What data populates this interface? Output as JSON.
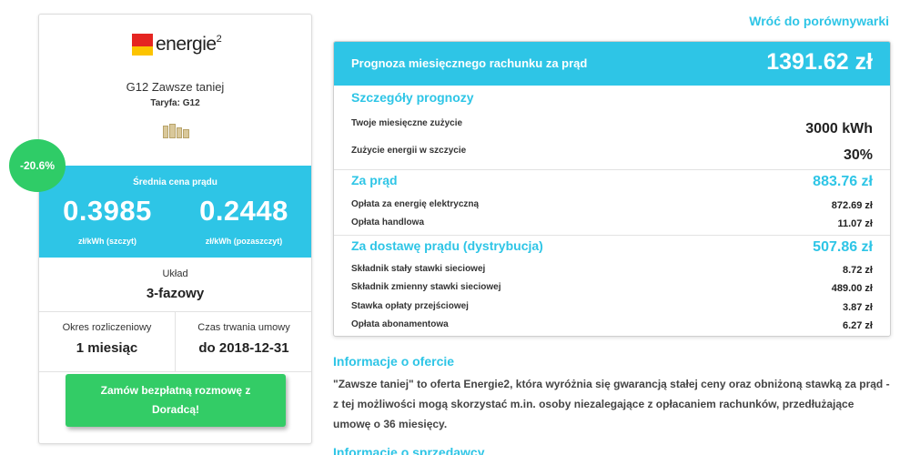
{
  "offer": {
    "brand_name": "energie",
    "brand_sup": "2",
    "tariff_name": "G12 Zawsze taniej",
    "tariff_code": "Taryfa: G12",
    "discount_badge": "-20.6%",
    "avg_price_label": "Średnia cena prądu",
    "peak_price": "0.3985",
    "peak_unit": "zł/kWh (szczyt)",
    "offpeak_price": "0.2448",
    "offpeak_unit": "zł/kWh (pozaszczyt)",
    "system_label": "Układ",
    "system_value": "3-fazowy",
    "billing_label": "Okres rozliczeniowy",
    "billing_value": "1 miesiąc",
    "contract_label": "Czas trwania umowy",
    "contract_value": "do 2018-12-31",
    "cta_label": "Zamów bezpłatną rozmowę z Doradcą!"
  },
  "back_link": "Wróć do porównywarki",
  "forecast": {
    "header_title": "Prognoza miesięcznego rachunku za prąd",
    "header_value": "1391.62 zł",
    "details_title": "Szczegóły prognozy",
    "usage_label": "Twoje miesięczne zużycie",
    "usage_value": "3000 kWh",
    "peak_share_label": "Zużycie energii w szczycie",
    "peak_share_value": "30%",
    "energy_title": "Za prąd",
    "energy_total": "883.76 zł",
    "energy_rows": [
      {
        "label": "Opłata za energię elektryczną",
        "value": "872.69 zł"
      },
      {
        "label": "Opłata handlowa",
        "value": "11.07 zł"
      }
    ],
    "dist_title": "Za dostawę prądu (dystrybucja)",
    "dist_total": "507.86 zł",
    "dist_rows": [
      {
        "label": "Składnik stały stawki sieciowej",
        "value": "8.72 zł"
      },
      {
        "label": "Składnik zmienny stawki sieciowej",
        "value": "489.00 zł"
      },
      {
        "label": "Stawka opłaty przejściowej",
        "value": "3.87 zł"
      },
      {
        "label": "Opłata abonamentowa",
        "value": "6.27 zł"
      }
    ]
  },
  "info": {
    "title": "Informacje o ofercie",
    "text": "\"Zawsze taniej\" to oferta Energie2, która wyróżnia się gwarancją stałej ceny oraz obniżoną stawką za prąd - z tej możliwości mogą skorzystać m.in. osoby niezalegające z opłacaniem rachunków, przedłużające umowę o 36 miesięcy.",
    "seller_title": "Informacje o sprzedawcy"
  },
  "colors": {
    "accent": "#2ec5e6",
    "cta_green": "#33cc66",
    "badge_green": "#2fcc67",
    "logo_red": "#e52521",
    "logo_yellow": "#fcc400"
  },
  "icons": [
    "energie2-logo",
    "building-icon"
  ]
}
